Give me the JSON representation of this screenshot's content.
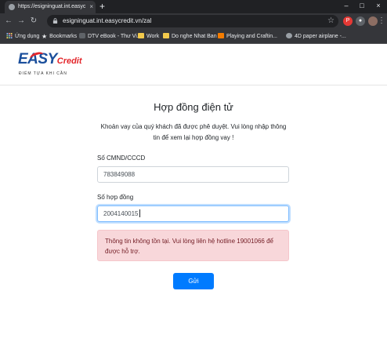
{
  "browser": {
    "tab_title": "https://esigninguat.int.easycredit...",
    "tab_close": "×",
    "new_tab": "+",
    "url": "esigninguat.int.easycredit.vn/zal",
    "window_controls": [
      "–",
      "□",
      "×"
    ],
    "bookmarks": [
      {
        "label": "Ứng dụng",
        "icon": "apps-grid-icon"
      },
      {
        "label": "Bookmarks",
        "icon": "star-icon"
      },
      {
        "label": "DTV eBook - Thư Vi...",
        "icon": "site-icon"
      },
      {
        "label": "Work",
        "icon": "folder-icon"
      },
      {
        "label": "Do nghe Nhat Ban",
        "icon": "folder-icon"
      },
      {
        "label": "Playing and Craftin...",
        "icon": "blogger-icon"
      },
      {
        "label": "4D paper airplane -...",
        "icon": "site-icon"
      }
    ]
  },
  "logo": {
    "easy": "EASY",
    "credit": "Credit",
    "tagline": "ĐIỂM TỰA KHI CẦN"
  },
  "form": {
    "title": "Hợp đồng điện tử",
    "description": "Khoản vay của quý khách đã được phê duyệt. Vui lòng nhập thông tin để xem lại hợp đồng vay !",
    "id_label": "Số CMND/CCCD",
    "id_value": "783849088",
    "contract_label": "Số hợp đồng",
    "contract_value": "2004140015",
    "error_message": "Thông tin không tồn tại. Vui lòng liên hệ hotline 19001066 để được hỗ trợ.",
    "submit_label": "Gửi"
  },
  "colors": {
    "brand_blue": "#1b4f9c",
    "brand_red": "#e3262b",
    "button": "#007bff",
    "alert_bg": "#f8d7da",
    "alert_text": "#721c24"
  }
}
